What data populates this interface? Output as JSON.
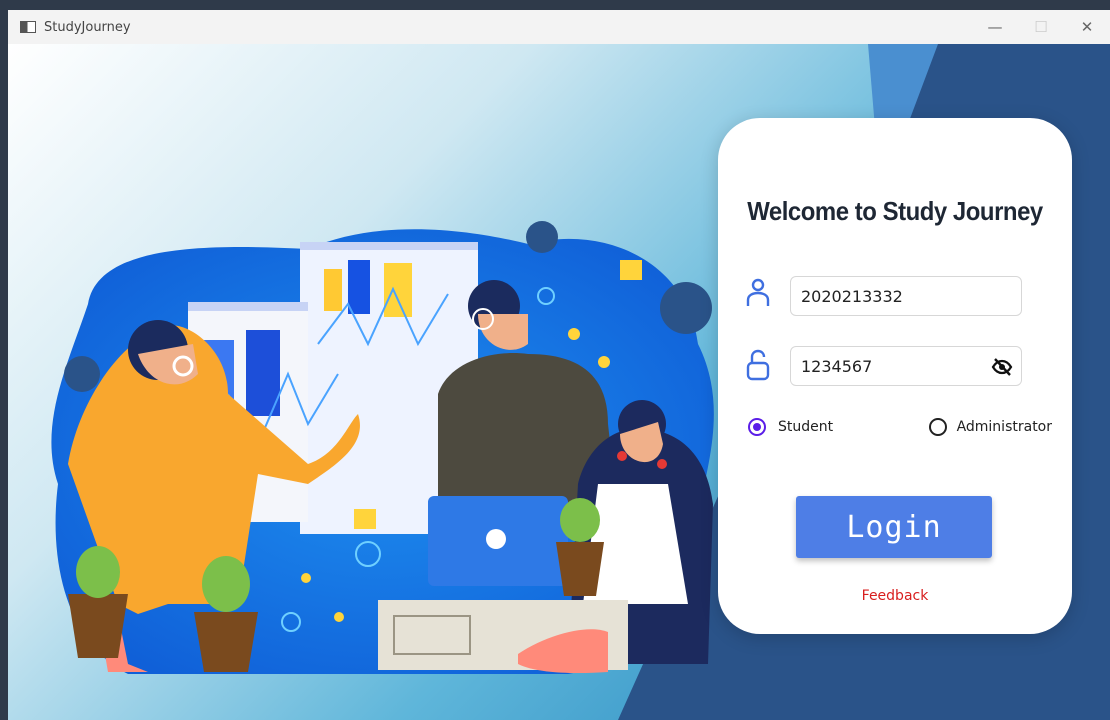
{
  "window": {
    "title": "StudyJourney",
    "controls": {
      "minimize": "—",
      "maximize": "☐",
      "close": "✕"
    }
  },
  "login": {
    "heading": "Welcome to Study Journey",
    "username_value": "2020213332",
    "password_value": "1234567",
    "roles": [
      {
        "label": "Student",
        "selected": true
      },
      {
        "label": "Administrator",
        "selected": false
      }
    ],
    "login_label": "Login",
    "feedback_label": "Feedback"
  },
  "colors": {
    "accent": "#4e7ee6",
    "radio_selected": "#5b1ee8",
    "feedback": "#d81e1e",
    "field_icon": "#3f6fe0",
    "panel_dark": "#2a5389"
  },
  "icons": [
    "user-icon",
    "unlock-icon",
    "eye-off-icon"
  ]
}
